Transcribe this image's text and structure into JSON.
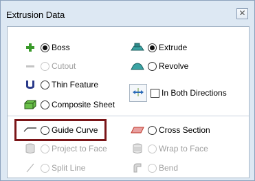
{
  "window": {
    "title": "Extrusion Data",
    "close_glyph": "✕"
  },
  "options": {
    "boss": "Boss",
    "cutout": "Cutout",
    "thin_feature": "Thin Feature",
    "composite_sheet": "Composite Sheet",
    "extrude": "Extrude",
    "revolve": "Revolve",
    "in_both_directions": "In Both Directions",
    "guide_curve": "Guide Curve",
    "cross_section": "Cross Section",
    "project_to_face": "Project to Face",
    "wrap_to_face": "Wrap to Face",
    "split_line": "Split Line",
    "bend": "Bend"
  },
  "state": {
    "boss_selected": true,
    "extrude_selected": true,
    "in_both_directions_checked": false
  },
  "colors": {
    "highlight_border": "#7a1518",
    "dialog_background": "#dde8f3",
    "boss_icon": "#3a9a2a",
    "extrude_icon": "#2d8a8a",
    "cross_section_icon": "#c0392b"
  }
}
